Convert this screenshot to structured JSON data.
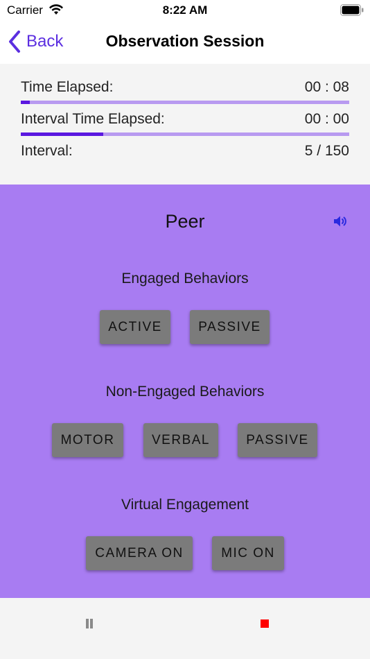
{
  "status_bar": {
    "carrier": "Carrier",
    "time": "8:22 AM",
    "wifi_icon": "wifi-icon",
    "battery_icon": "battery-full-icon"
  },
  "nav": {
    "back_label": "Back",
    "title": "Observation Session"
  },
  "timers": {
    "time_elapsed_label": "Time Elapsed:",
    "time_elapsed_value": "00 : 08",
    "time_elapsed_progress": 0.027,
    "interval_time_label": "Interval Time Elapsed:",
    "interval_time_value": "00 : 00",
    "interval_time_progress": 0.25,
    "interval_label": "Interval:",
    "interval_value": "5 / 150"
  },
  "observation": {
    "subject": "Peer",
    "sound_icon": "speaker-icon",
    "engaged_label": "Engaged Behaviors",
    "engaged_buttons": [
      "ACTIVE",
      "PASSIVE"
    ],
    "non_engaged_label": "Non-Engaged Behaviors",
    "non_engaged_buttons": [
      "MOTOR",
      "VERBAL",
      "PASSIVE"
    ],
    "virtual_label": "Virtual Engagement",
    "virtual_buttons": [
      "CAMERA ON",
      "MIC ON"
    ]
  },
  "toolbar": {
    "pause_icon": "pause-icon",
    "stop_icon": "stop-icon"
  },
  "colors": {
    "accent": "#5b2ee0",
    "panel_purple": "#a87cf2",
    "progress_track": "#b89af0",
    "progress_fill": "#5b18e0",
    "button_gray": "#7b7b7b",
    "stop_red": "#ff0000"
  }
}
